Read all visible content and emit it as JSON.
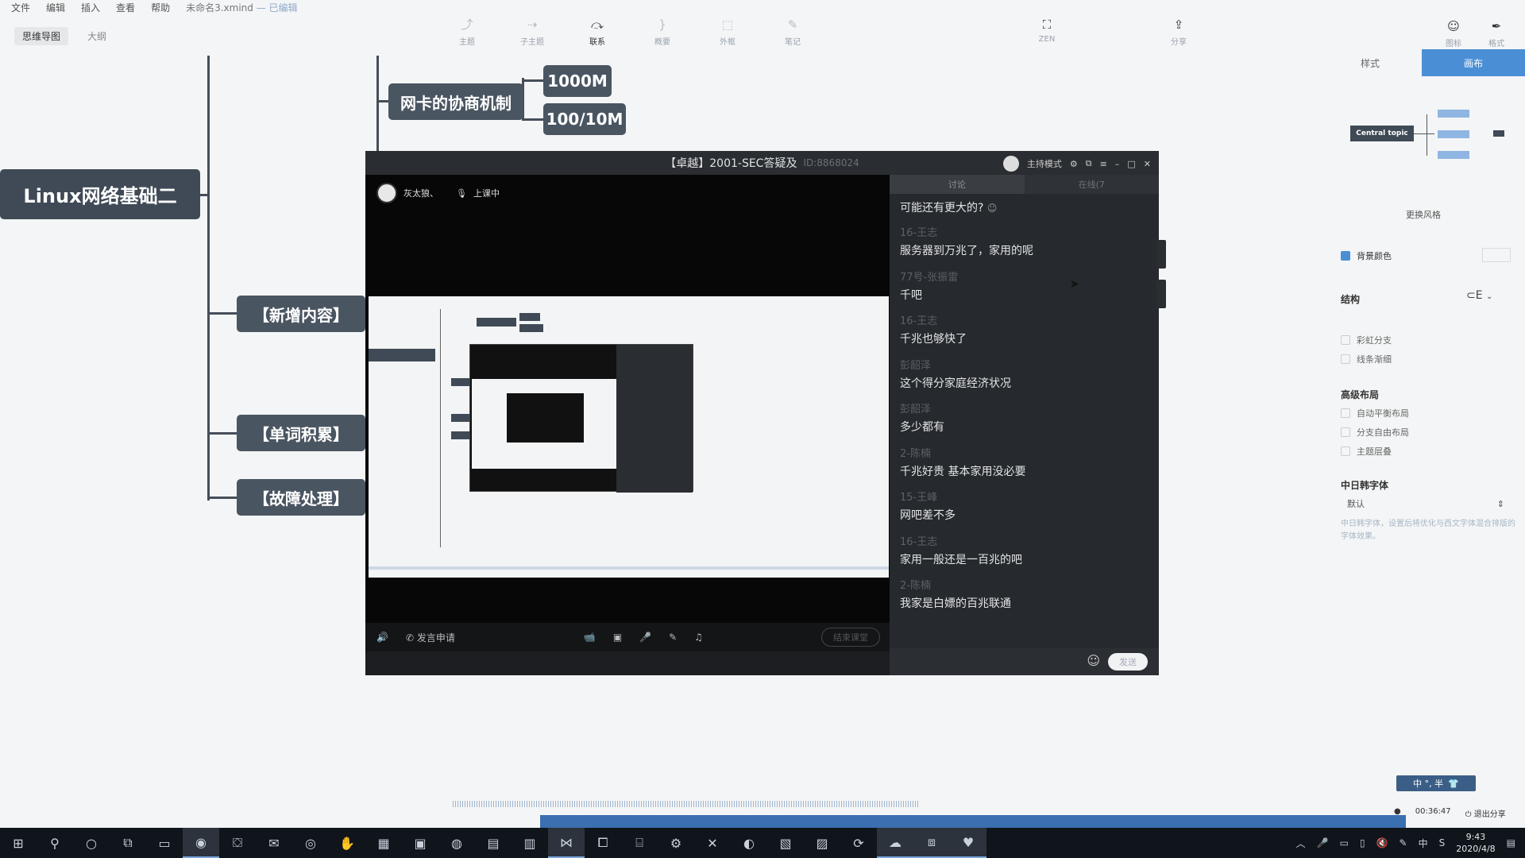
{
  "menu": {
    "items": [
      "文件",
      "编辑",
      "插入",
      "查看",
      "帮助"
    ],
    "doc_title": "未命名3.xmind",
    "doc_status": "— 已编辑"
  },
  "view_tabs": [
    "思维导图",
    "大纲"
  ],
  "toolbar": {
    "items": [
      {
        "label": "主题",
        "icon": "add-topic-icon"
      },
      {
        "label": "子主题",
        "icon": "add-subtopic-icon"
      },
      {
        "label": "联系",
        "icon": "relationship-icon"
      },
      {
        "label": "概要",
        "icon": "summary-icon"
      },
      {
        "label": "外框",
        "icon": "boundary-icon"
      },
      {
        "label": "笔记",
        "icon": "note-icon"
      }
    ],
    "zen": "ZEN",
    "share": "分享",
    "right": [
      {
        "label": "图标",
        "icon": "smiley-icon"
      },
      {
        "label": "格式",
        "icon": "format-brush-icon"
      }
    ]
  },
  "mindmap": {
    "root": "Linux网络基础二",
    "branch_top": "网卡的协商机制",
    "leaf_1": "1000M",
    "leaf_2": "100/10M",
    "branches": [
      "【新增内容】",
      "【单词积累】",
      "【故障处理】"
    ]
  },
  "props": {
    "tabs": [
      "样式",
      "画布"
    ],
    "preview_topic": "Central topic",
    "change_style": "更换风格",
    "bg_color": "背景颜色",
    "structure": "结构",
    "rainbow": "彩虹分支",
    "thin_line": "线条渐细",
    "advanced_layout": "高级布局",
    "auto_balance": "自动平衡布局",
    "free_layout": "分支自由布局",
    "overlap": "主题层叠",
    "cjk_font": "中日韩字体",
    "font_value": "默认",
    "font_hint": "中日韩字体，设置后将优化与西文字体混合排版的字体效果。"
  },
  "live": {
    "title": "【卓越】2001-SEC答疑及",
    "room_id": "ID:8868024",
    "host_mode": "主持模式",
    "presenter": "灰太狼、",
    "status": "上课中",
    "apply_speak": "发言申请",
    "end_class": "结束课堂",
    "chat_tabs": [
      "讨论",
      "在线(7"
    ],
    "send": "发送",
    "messages": [
      {
        "who": "",
        "text": "可能还有更大的?"
      },
      {
        "who": "16-王志",
        "text": "服务器到万兆了，家用的呢"
      },
      {
        "who": "77号-张振雷",
        "text": "千吧"
      },
      {
        "who": "16-王志",
        "text": "千兆也够快了"
      },
      {
        "who": "彭韶泽",
        "text": "这个得分家庭经济状况"
      },
      {
        "who": "彭韶泽",
        "text": "多少都有"
      },
      {
        "who": "2-陈楠",
        "text": "千兆好贵 基本家用没必要"
      },
      {
        "who": "15-王峰",
        "text": "网吧差不多"
      },
      {
        "who": "16-王志",
        "text": "家用一般还是一百兆的吧"
      },
      {
        "who": "2-陈楠",
        "text": "我家是白嫖的百兆联通"
      }
    ]
  },
  "status": {
    "timer": "00:36:47",
    "exit_share": "退出分享"
  },
  "ime": "中 °, 半",
  "clock": {
    "time": "9:43",
    "date": "2020/4/8"
  }
}
